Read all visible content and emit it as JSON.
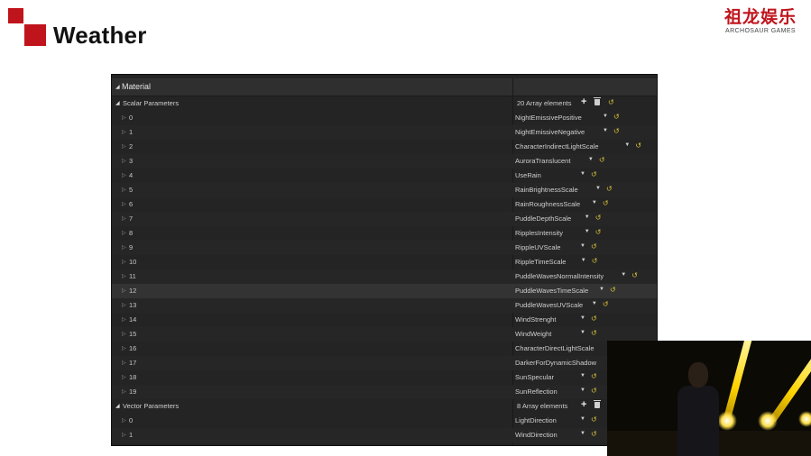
{
  "slide": {
    "title": "Weather",
    "brand_cn": "祖龙娱乐",
    "brand_en": "ARCHOSAUR GAMES"
  },
  "panel": {
    "section_label": "Material",
    "scalar_group": {
      "label": "Scalar Parameters",
      "count": "20 Array elements",
      "items": [
        {
          "index": "0",
          "name": "NightEmissivePositive"
        },
        {
          "index": "1",
          "name": "NightEmissiveNegative"
        },
        {
          "index": "2",
          "name": "CharacterIndirectLightScale"
        },
        {
          "index": "3",
          "name": "AuroraTranslucent"
        },
        {
          "index": "4",
          "name": "UseRain"
        },
        {
          "index": "5",
          "name": "RainBrightnessScale"
        },
        {
          "index": "6",
          "name": "RainRoughnessScale"
        },
        {
          "index": "7",
          "name": "PuddleDepthScale"
        },
        {
          "index": "8",
          "name": "RipplesIntensity"
        },
        {
          "index": "9",
          "name": "RippleUVScale"
        },
        {
          "index": "10",
          "name": "RippleTimeScale"
        },
        {
          "index": "11",
          "name": "PuddleWavesNormalIntensity"
        },
        {
          "index": "12",
          "name": "PuddleWavesTimeScale"
        },
        {
          "index": "13",
          "name": "PuddleWavesUVScale"
        },
        {
          "index": "14",
          "name": "WindStrenght"
        },
        {
          "index": "15",
          "name": "WindWeight"
        },
        {
          "index": "16",
          "name": "CharacterDirectLightScale"
        },
        {
          "index": "17",
          "name": "DarkerForDynamicShadow"
        },
        {
          "index": "18",
          "name": "SunSpecular"
        },
        {
          "index": "19",
          "name": "SunReflection"
        }
      ]
    },
    "vector_group": {
      "label": "Vector Parameters",
      "count": "8 Array elements",
      "items": [
        {
          "index": "0",
          "name": "LightDirection"
        },
        {
          "index": "1",
          "name": "WindDirection"
        }
      ]
    },
    "highlighted_row": "12"
  },
  "colors": {
    "accent_red": "#c0141c",
    "reset_arrow": "#d8c23a"
  },
  "icons": {
    "expand": "triangle-right",
    "collapse": "triangle-down",
    "dropdown": "caret-down",
    "reset": "reset-arrow",
    "add": "plus",
    "delete": "trash"
  }
}
